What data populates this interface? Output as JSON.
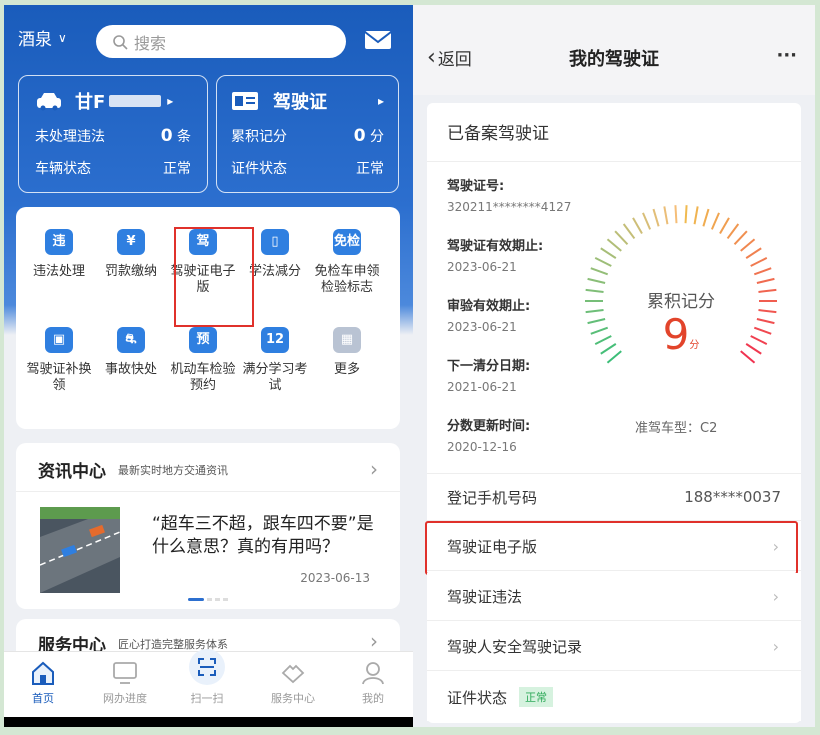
{
  "left": {
    "city": "酒泉",
    "search_placeholder": "搜索",
    "vehicle": {
      "plate": "甘F",
      "violation_label": "未处理违法",
      "violation_count": "0",
      "violation_unit": "条",
      "status_label": "车辆状态",
      "status_value": "正常"
    },
    "license": {
      "title": "驾驶证",
      "points_label": "累积记分",
      "points_value": "0",
      "points_unit": "分",
      "status_label": "证件状态",
      "status_value": "正常"
    },
    "grid": [
      {
        "label": "违法处理",
        "glyph": "违",
        "color": "#2f7fe0"
      },
      {
        "label": "罚款缴纳",
        "glyph": "¥",
        "color": "#2f7fe0"
      },
      {
        "label": "驾驶证电子版",
        "glyph": "驾",
        "color": "#2f7fe0"
      },
      {
        "label": "学法减分",
        "glyph": "▯",
        "color": "#2f7fe0"
      },
      {
        "label": "免检车申领检验标志",
        "glyph": "免检",
        "color": "#2f7fe0"
      },
      {
        "label": "驾驶证补换领",
        "glyph": "▣",
        "color": "#2f7fe0"
      },
      {
        "label": "事故快处",
        "glyph": "⛐",
        "color": "#2f7fe0"
      },
      {
        "label": "机动车检验预约",
        "glyph": "预",
        "color": "#2f7fe0"
      },
      {
        "label": "满分学习考试",
        "glyph": "12",
        "color": "#2f7fe0"
      },
      {
        "label": "更多",
        "glyph": "▦",
        "color": "#b9c3d3"
      }
    ],
    "news": {
      "title": "资讯中心",
      "subtitle": "最新实时地方交通资讯",
      "headline": "“超车三不超，跟车四不要”是什么意思？真的有用吗？",
      "date": "2023-06-13"
    },
    "service": {
      "title": "服务中心",
      "subtitle": "匠心打造完整服务体系"
    },
    "nav": [
      {
        "label": "首页"
      },
      {
        "label": "网办进度"
      },
      {
        "label": "扫一扫"
      },
      {
        "label": "服务中心"
      },
      {
        "label": "我的"
      }
    ],
    "colors": {
      "primary": "#1a5cbb",
      "highlight": "#e0312b"
    }
  },
  "right": {
    "back": "返回",
    "title": "我的驾驶证",
    "more": "···",
    "section_title": "已备案驾驶证",
    "fields": [
      {
        "key": "驾驶证号:",
        "value": "320211********4127"
      },
      {
        "key": "驾驶证有效期止:",
        "value": "2023-06-21"
      },
      {
        "key": "审验有效期止:",
        "value": "2023-06-21"
      },
      {
        "key": "下一清分日期:",
        "value": "2021-06-21"
      },
      {
        "key": "分数更新时间:",
        "value": "2020-12-16"
      }
    ],
    "gauge": {
      "label": "累积记分",
      "value": "9",
      "unit": "分",
      "vehicle_type": "准驾车型：C2"
    },
    "phone_label": "登记手机号码",
    "phone_value": "188****0037",
    "menu": [
      "驾驶证电子版",
      "驾驶证违法",
      "驾驶人安全驾驶记录"
    ],
    "cert_status_label": "证件状态",
    "cert_status_value": "正常"
  }
}
